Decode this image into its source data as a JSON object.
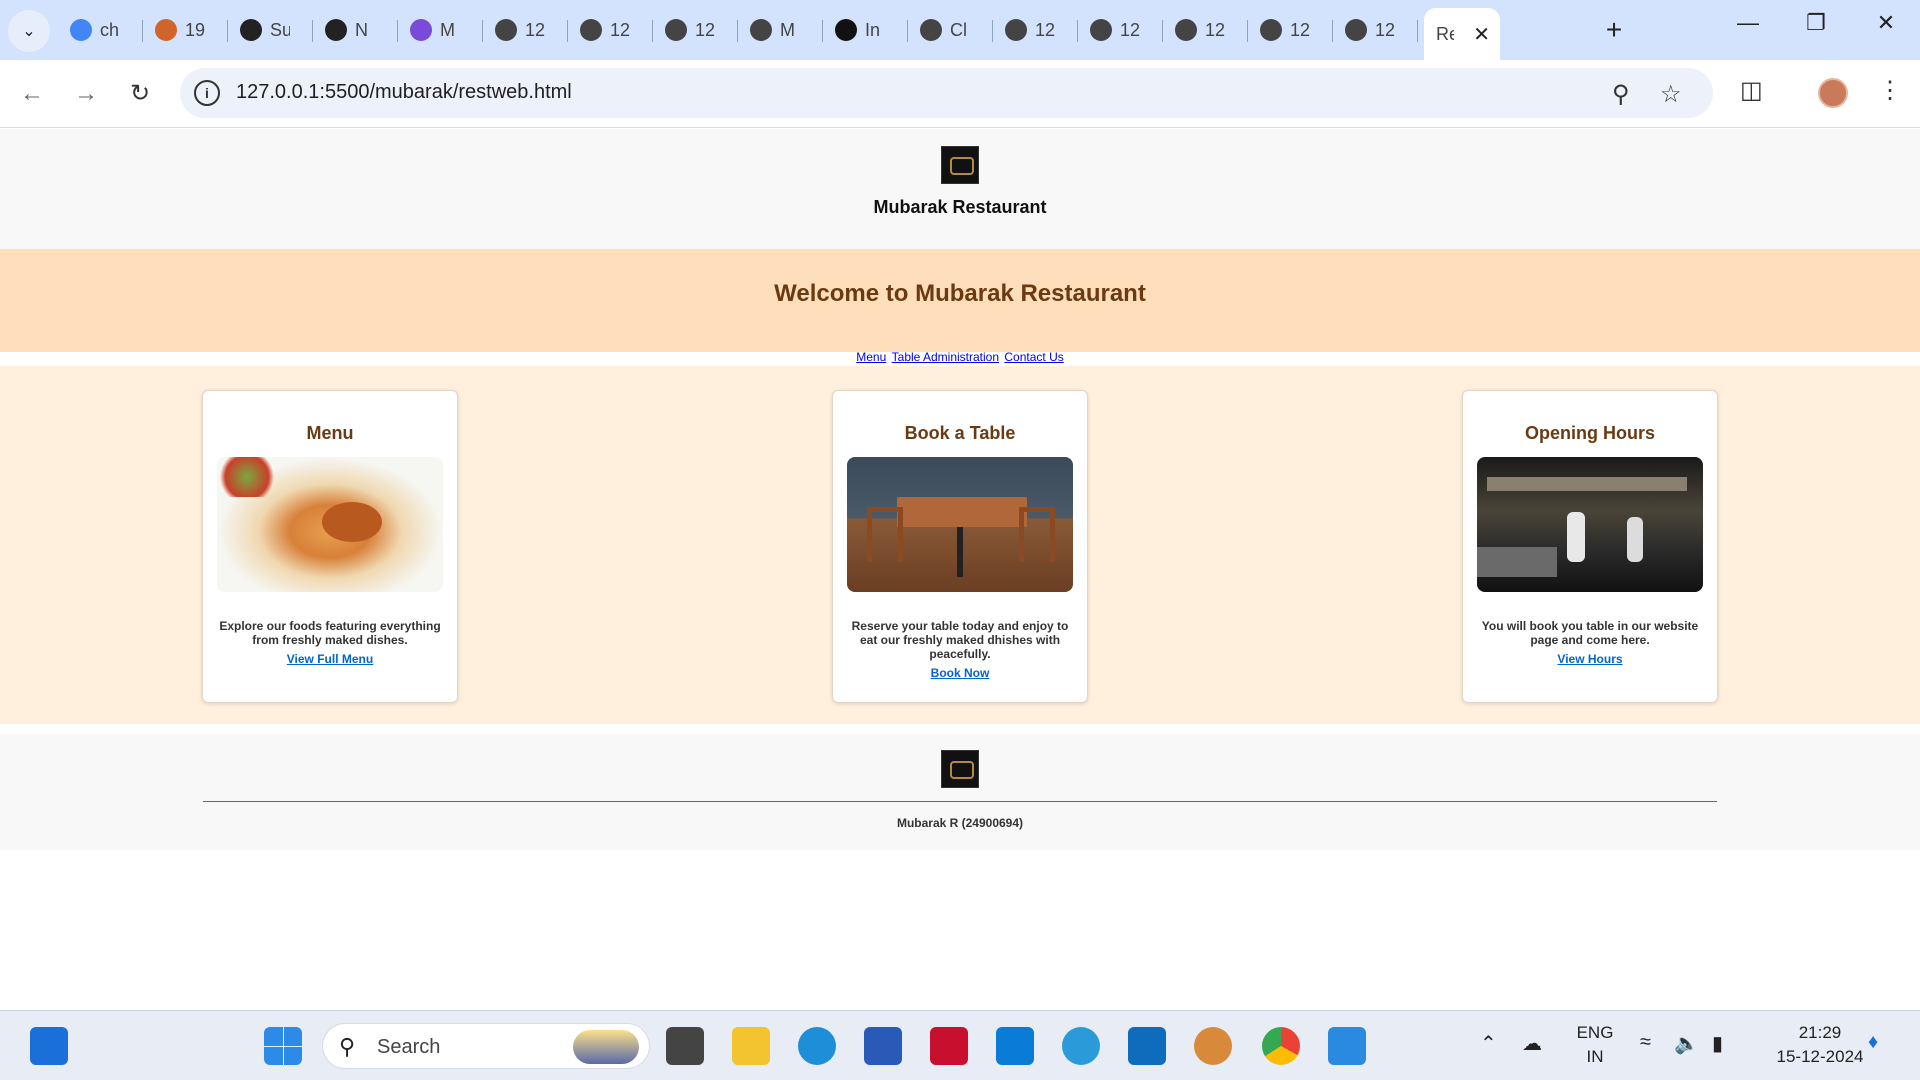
{
  "browser": {
    "tabs": [
      {
        "title": "ch",
        "icon": "google-icon",
        "color": "#4285f4"
      },
      {
        "title": "19",
        "icon": "site-icon",
        "color": "#d0642a"
      },
      {
        "title": "Su",
        "icon": "github-icon",
        "color": "#222222"
      },
      {
        "title": "N",
        "icon": "openai-icon",
        "color": "#222222"
      },
      {
        "title": "M",
        "icon": "copilot-icon",
        "color": "#7a4ad8"
      },
      {
        "title": "12",
        "icon": "globe-icon",
        "color": "#444444"
      },
      {
        "title": "12",
        "icon": "globe-icon",
        "color": "#444444"
      },
      {
        "title": "12",
        "icon": "globe-icon",
        "color": "#444444"
      },
      {
        "title": "M",
        "icon": "globe-icon",
        "color": "#444444"
      },
      {
        "title": "In",
        "icon": "chatgpt-icon",
        "color": "#111111"
      },
      {
        "title": "Cl",
        "icon": "chatgpt-icon",
        "color": "#444444"
      },
      {
        "title": "12",
        "icon": "globe-icon",
        "color": "#444444"
      },
      {
        "title": "12",
        "icon": "globe-icon",
        "color": "#444444"
      },
      {
        "title": "12",
        "icon": "globe-icon",
        "color": "#444444"
      },
      {
        "title": "12",
        "icon": "globe-icon",
        "color": "#444444"
      },
      {
        "title": "12",
        "icon": "globe-icon",
        "color": "#444444"
      }
    ],
    "active_tab": {
      "title": "Re"
    },
    "url": "127.0.0.1:5500/mubarak/restweb.html"
  },
  "site": {
    "name": "Mubarak Restaurant",
    "welcome": "Welcome to Mubarak Restaurant",
    "nav": [
      "Menu",
      "Table Administration",
      "Contact Us"
    ],
    "cards": [
      {
        "title": "Menu",
        "desc": "Explore our foods featuring everything from freshly maked dishes.",
        "link": "View Full Menu"
      },
      {
        "title": "Book a Table",
        "desc": "Reserve your table today and enjoy to eat our freshly maked dhishes with peacefully.",
        "link": "Book Now"
      },
      {
        "title": "Opening Hours",
        "desc": "You will book you table in our website page and come here.",
        "link": "View Hours"
      }
    ],
    "footer": "Mubarak R (24900694)"
  },
  "taskbar": {
    "search_placeholder": "Search",
    "lang": [
      "ENG",
      "IN"
    ],
    "time": "21:29",
    "date": "15-12-2024"
  }
}
